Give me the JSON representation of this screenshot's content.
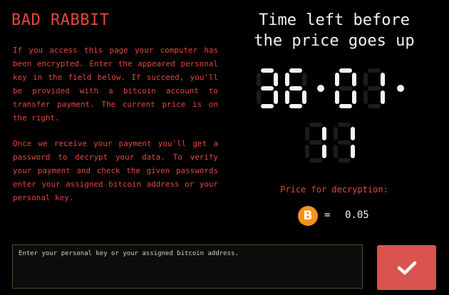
{
  "title": "BAD RABBIT",
  "message": {
    "paragraph1": "If you access this page your computer has been encrypted. Enter the appeared personal key in the field below. If succeed, you'll be provided with a bitcoin account to transfer payment. The current price is on the right.",
    "paragraph2": "Once we receive your payment you'll get a password to decrypt your data. To verify your payment and check the given passwords enter your assigned bitcoin address or your personal key."
  },
  "timer": {
    "heading_line1": "Time left before",
    "heading_line2": "the price goes up",
    "hours": "36",
    "minutes": "01",
    "seconds": "11"
  },
  "price": {
    "label": "Price for decryption:",
    "currency_symbol": "B",
    "equals": "=",
    "amount": "0.05"
  },
  "key_field": {
    "placeholder": "Enter your personal key or your assigned bitcoin address.",
    "value": ""
  },
  "submit": {
    "icon": "checkmark-icon"
  },
  "colors": {
    "background": "#000000",
    "accent_red": "#e2483d",
    "button_red": "#d9534f",
    "bitcoin_orange": "#f7931a",
    "text_light": "#f2f2f2"
  }
}
